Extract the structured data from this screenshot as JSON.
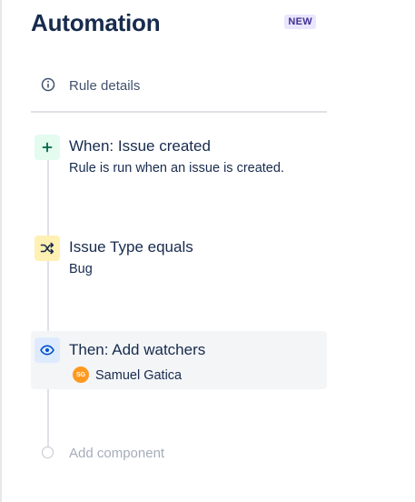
{
  "header": {
    "title": "Automation",
    "badge": "NEW"
  },
  "rule_details": {
    "label": "Rule details",
    "icon": "info-icon"
  },
  "steps": [
    {
      "type": "trigger",
      "icon": "plus-icon",
      "title": "When: Issue created",
      "description": "Rule is run when an issue is created.",
      "icon_bg": "#e3fcef",
      "icon_color": "#006644"
    },
    {
      "type": "condition",
      "icon": "shuffle-icon",
      "title": "Issue Type equals",
      "description": "Bug",
      "icon_bg": "#fff0b3",
      "icon_color": "#172b4d"
    },
    {
      "type": "action",
      "icon": "eye-icon",
      "title": "Then: Add watchers",
      "icon_bg": "#deebff",
      "icon_color": "#0052cc",
      "watcher": {
        "initials": "SG",
        "name": "Samuel Gatica",
        "avatar_color": "#ff991f"
      }
    }
  ],
  "add_component": {
    "label": "Add component"
  }
}
